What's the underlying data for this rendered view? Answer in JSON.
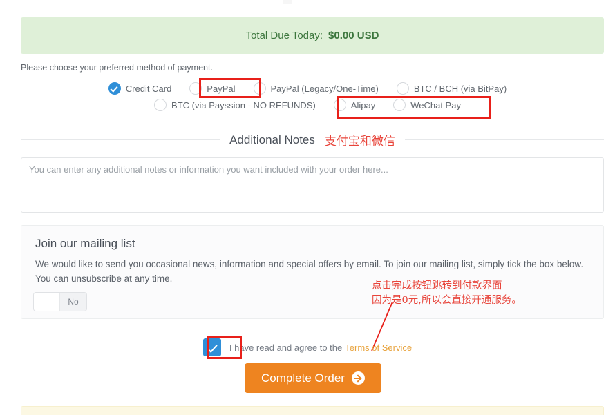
{
  "banner": {
    "label": "Total Due Today:",
    "amount": "$0.00 USD",
    "bg_color": "#dff0d8",
    "text_color": "#3c763d"
  },
  "payment": {
    "prompt": "Please choose your preferred method of payment.",
    "row1": [
      {
        "label": "Credit Card",
        "checked": true
      },
      {
        "label": "PayPal",
        "checked": false
      },
      {
        "label": "PayPal (Legacy/One-Time)",
        "checked": false
      },
      {
        "label": "BTC / BCH (via BitPay)",
        "checked": false
      }
    ],
    "row2": [
      {
        "label": "BTC (via Payssion - NO REFUNDS)",
        "checked": false
      },
      {
        "label": "Alipay",
        "checked": false
      },
      {
        "label": "WeChat Pay",
        "checked": false
      }
    ]
  },
  "notes_section": {
    "title": "Additional Notes",
    "annotation_cn": "支付宝和微信",
    "annotation_color": "#e8443a",
    "placeholder": "You can enter any additional notes or information you want included with your order here...",
    "value": ""
  },
  "mailing": {
    "heading": "Join our mailing list",
    "body": "We would like to send you occasional news, information and special offers by email. To join our mailing list, simply tick the box below. You can unsubscribe at any time.",
    "toggle_state": "No"
  },
  "annotation": {
    "line1": "点击完成按钮跳转到付款界面",
    "line2": "因为是0元,所以会直接开通服务。",
    "color": "#e8453b"
  },
  "terms": {
    "text": "I have read and agree to the",
    "link": "Terms of Service",
    "checked": true,
    "link_color": "#e8a33d"
  },
  "complete_button": {
    "label": "Complete Order",
    "icon": "arrow-right-circle-icon",
    "bg_color": "#ee8420"
  },
  "highlights": {
    "color": "#e8201a",
    "boxes": [
      "paypal-option",
      "alipay-wechat-options",
      "terms-checkbox"
    ]
  }
}
